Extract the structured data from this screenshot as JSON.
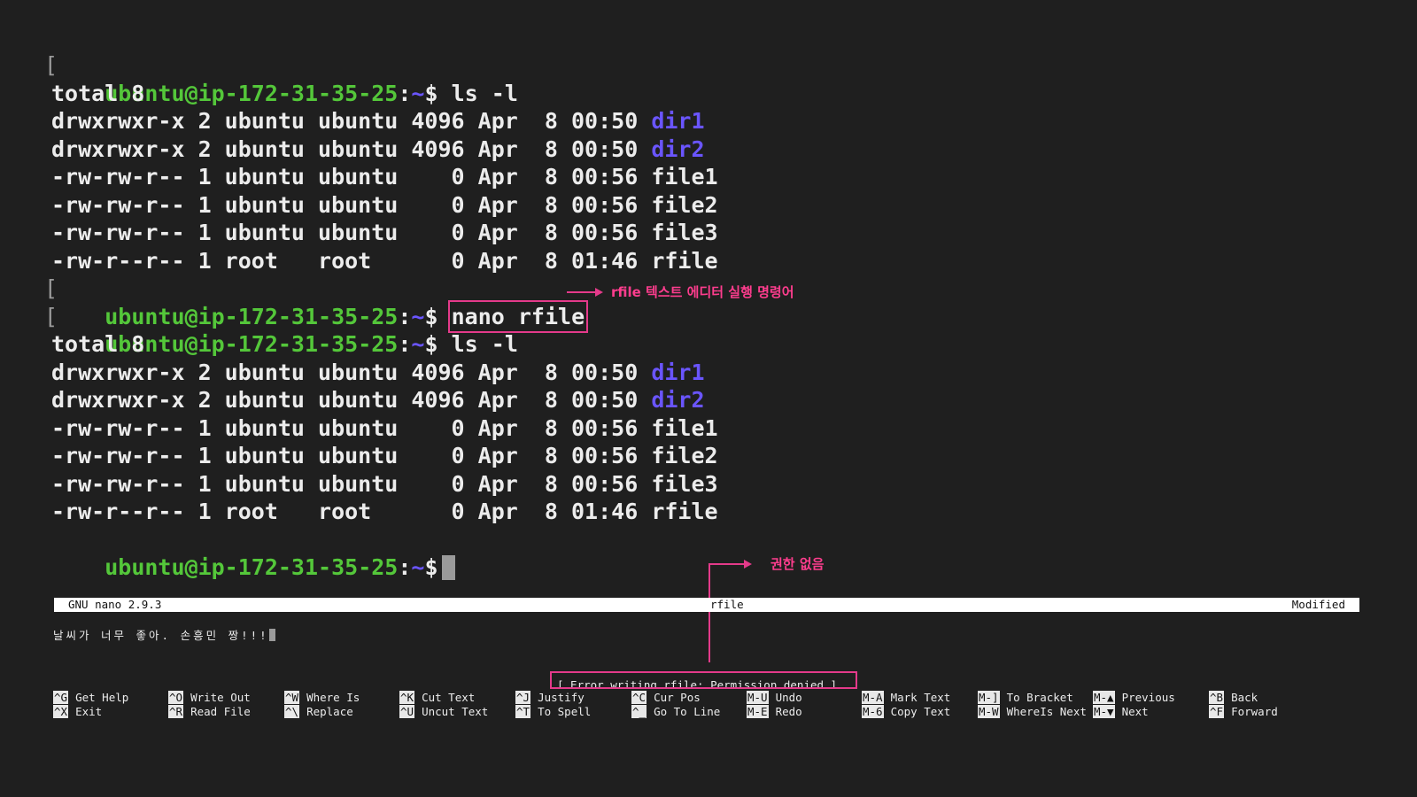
{
  "prompt": {
    "user": "ubuntu@ip-172-31-35-25",
    "path": "~",
    "sigil": "$",
    "colon": ":"
  },
  "commands": {
    "ls": "ls -l",
    "nano": "nano rfile"
  },
  "listing": {
    "total": "total 8",
    "rows": [
      {
        "prefix": "drwxrwxr-x 2 ubuntu ubuntu 4096 Apr  8 00:50 ",
        "name": "dir1",
        "is_dir": true
      },
      {
        "prefix": "drwxrwxr-x 2 ubuntu ubuntu 4096 Apr  8 00:50 ",
        "name": "dir2",
        "is_dir": true
      },
      {
        "prefix": "-rw-rw-r-- 1 ubuntu ubuntu    0 Apr  8 00:56 ",
        "name": "file1",
        "is_dir": false
      },
      {
        "prefix": "-rw-rw-r-- 1 ubuntu ubuntu    0 Apr  8 00:56 ",
        "name": "file2",
        "is_dir": false
      },
      {
        "prefix": "-rw-rw-r-- 1 ubuntu ubuntu    0 Apr  8 00:56 ",
        "name": "file3",
        "is_dir": false
      },
      {
        "prefix": "-rw-r--r-- 1 root   root      0 Apr  8 01:46 ",
        "name": "rfile",
        "is_dir": false
      }
    ]
  },
  "annotations": {
    "nano_note": "rfile 텍스트 에디터 실행 명령어",
    "permission_note": "권한 없음"
  },
  "nano": {
    "version": "GNU nano 2.9.3",
    "filename": "rfile",
    "state": "Modified",
    "content": "날씨가 너무 좋아. 손흥민 짱!!!",
    "status_message": "[ Error writing rfile: Permission denied ]",
    "shortcuts_row1": [
      {
        "key": "^G",
        "label": "Get Help"
      },
      {
        "key": "^O",
        "label": "Write Out"
      },
      {
        "key": "^W",
        "label": "Where Is"
      },
      {
        "key": "^K",
        "label": "Cut Text"
      },
      {
        "key": "^J",
        "label": "Justify"
      },
      {
        "key": "^C",
        "label": "Cur Pos"
      },
      {
        "key": "M-U",
        "label": "Undo"
      },
      {
        "key": "M-A",
        "label": "Mark Text"
      },
      {
        "key": "M-]",
        "label": "To Bracket"
      },
      {
        "key": "M-▲",
        "label": "Previous"
      },
      {
        "key": "^B",
        "label": "Back"
      }
    ],
    "shortcuts_row2": [
      {
        "key": "^X",
        "label": "Exit"
      },
      {
        "key": "^R",
        "label": "Read File"
      },
      {
        "key": "^\\",
        "label": "Replace"
      },
      {
        "key": "^U",
        "label": "Uncut Text"
      },
      {
        "key": "^T",
        "label": "To Spell"
      },
      {
        "key": "^_",
        "label": "Go To Line"
      },
      {
        "key": "M-E",
        "label": "Redo"
      },
      {
        "key": "M-6",
        "label": "Copy Text"
      },
      {
        "key": "M-W",
        "label": "WhereIs Next"
      },
      {
        "key": "M-▼",
        "label": "Next"
      },
      {
        "key": "^F",
        "label": "Forward"
      }
    ]
  },
  "colors": {
    "user": "#54c73a",
    "path": "#6a55ff",
    "annotation": "#ff3d8e"
  }
}
